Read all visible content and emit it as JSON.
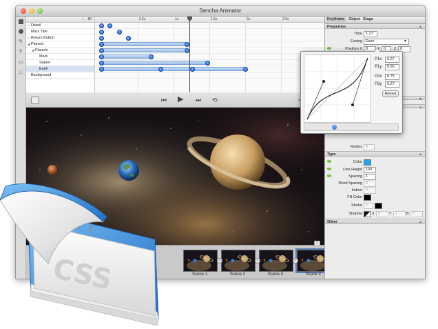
{
  "window": {
    "title": "Sencha Animator"
  },
  "layers": {
    "count": "86",
    "rows": [
      {
        "label": "Detail",
        "arrow": "▷",
        "indent": 0
      },
      {
        "label": "Mars Title",
        "arrow": "",
        "indent": 0
      },
      {
        "label": "Return Button",
        "arrow": "▷",
        "indent": 0
      },
      {
        "label": "Planets",
        "arrow": "◢",
        "indent": 0
      },
      {
        "label": "Planets",
        "arrow": "◢",
        "indent": 1
      },
      {
        "label": "Mars",
        "arrow": "",
        "indent": 2
      },
      {
        "label": "Saturn",
        "arrow": "",
        "indent": 2
      },
      {
        "label": "Earth",
        "arrow": "",
        "indent": 2
      },
      {
        "label": "Background",
        "arrow": "",
        "indent": 0
      }
    ]
  },
  "timeline": {
    "ticks": [
      "0.5s",
      "1s",
      "1.5s",
      "2s",
      "2.5s"
    ]
  },
  "transport": {
    "rewind": "⏮",
    "play": "▶",
    "forward": "⏭",
    "loop": "⟲"
  },
  "scenes": {
    "add": "+",
    "items": [
      {
        "label": "Scene 1"
      },
      {
        "label": "Scene 2"
      },
      {
        "label": "Scene 3"
      },
      {
        "label": "Scene 4"
      }
    ]
  },
  "inspector": {
    "tabs": [
      "Keyframe",
      "Object",
      "Stage"
    ],
    "properties_title": "Properties",
    "time_label": "Time",
    "time_value": "1.27",
    "easing_label": "Easing",
    "easing_value": "Ease",
    "position_label": "Position X",
    "pos_x": "0",
    "pos_y_label": "Y",
    "pos_y": "0",
    "pos_z_label": "Z",
    "pos_z": "0",
    "radius_label": "Radius",
    "radius_value": "4",
    "type_title": "Type",
    "color_label": "Color",
    "line_height_label": "Line Height",
    "line_height_value": "100",
    "spacing_label": "Spacing",
    "spacing_value": "1",
    "word_spacing_label": "Word Spacing",
    "word_spacing_value": "0",
    "indent_label": "Indent",
    "indent_value": "0",
    "fill_color_label": "Fill Color",
    "stroke_label": "Stroke",
    "stroke_value": "1",
    "shadow_label": "Shadow",
    "shadow_x_label": "X",
    "shadow_x": "0",
    "shadow_y_label": "Y",
    "shadow_y": "1",
    "shadow_b_label": "B",
    "shadow_b": "0",
    "other_title": "Other"
  },
  "easing_popup": {
    "p1x_label": "P1x",
    "p1x": "0.27",
    "p1y_label": "P1y",
    "p1y": "0.65",
    "p2x_label": "P2x",
    "p2x": "0.75",
    "p2y_label": "P2y",
    "p2y": "0.27",
    "revert": "Revert"
  },
  "css_icon": {
    "text": "CSS"
  },
  "colors": {
    "accent": "#1c5ad1",
    "type_color": "#29a3e8",
    "selection": "#d6e2f3"
  }
}
